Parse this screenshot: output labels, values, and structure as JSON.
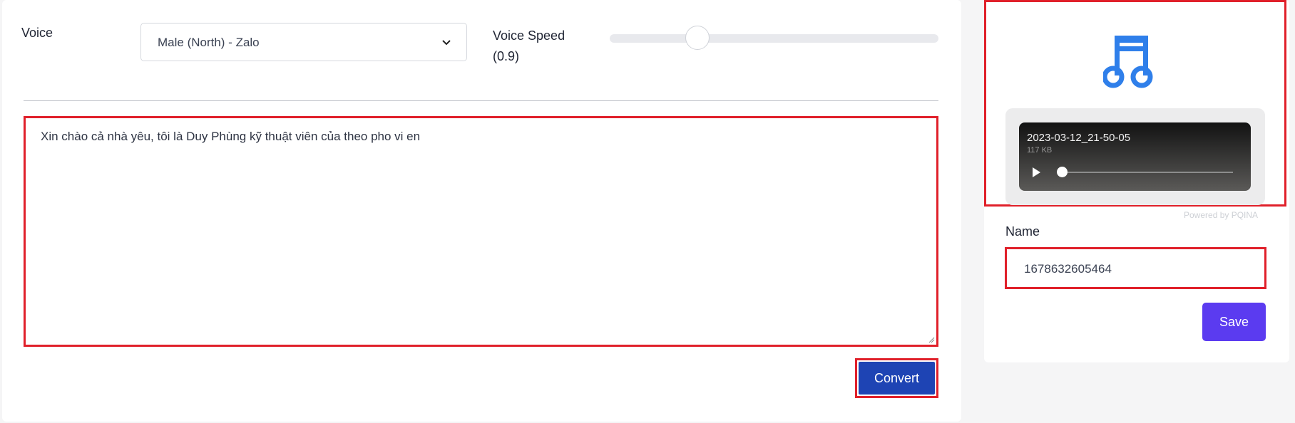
{
  "form": {
    "voice_label": "Voice",
    "voice_value": "Male (North) - Zalo",
    "speed_label": "Voice Speed",
    "speed_value_text": "(0.9)",
    "speed_value": 0.9,
    "text": "Xin chào cả nhà yêu, tôi là Duy Phùng kỹ thuật viên của theo pho vi en",
    "convert_label": "Convert"
  },
  "audio": {
    "icon": "music-note-icon",
    "file_name": "2023-03-12_21-50-05",
    "file_size": "117 KB",
    "powered_by": "Powered by PQINA"
  },
  "save_form": {
    "name_label": "Name",
    "name_value": "1678632605464",
    "save_label": "Save"
  },
  "colors": {
    "highlight": "#e0202a",
    "convert": "#1e44b4",
    "save": "#5b3bf0",
    "icon": "#2f7fea"
  }
}
